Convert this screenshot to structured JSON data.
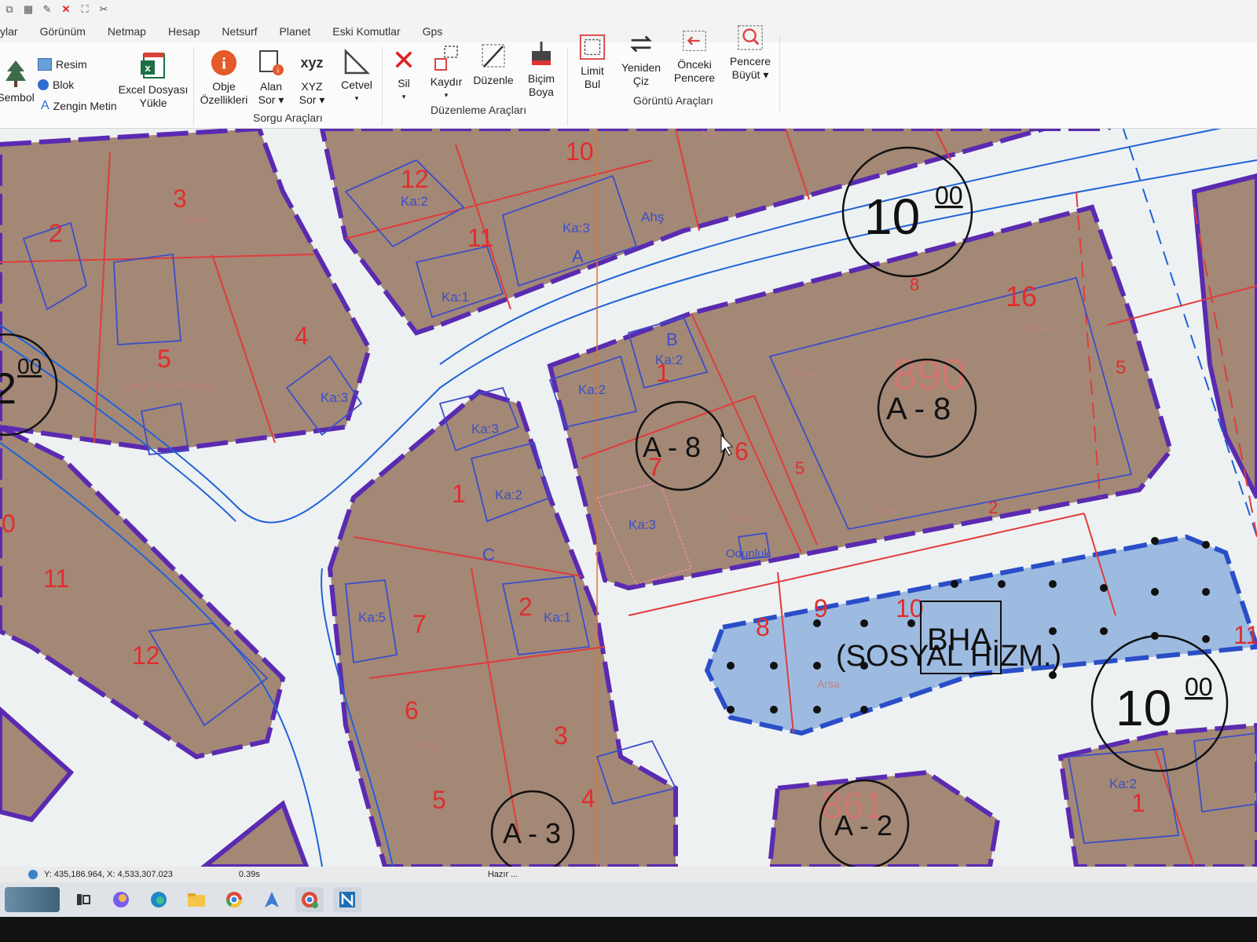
{
  "qat": {
    "icons": [
      "layers-icon",
      "grid-icon",
      "edit-icon",
      "delete-icon",
      "select-icon",
      "cut-icon"
    ]
  },
  "tabs": [
    "ylar",
    "Görünüm",
    "Netmap",
    "Hesap",
    "Netsurf",
    "Planet",
    "Eski Komutlar",
    "Gps"
  ],
  "ribbon": {
    "sembol": "Sembol",
    "resim": "Resim",
    "blok": "Blok",
    "zengin_metin": "Zengin Metin",
    "excel_line1": "Excel Dosyası",
    "excel_line2": "Yükle",
    "obje_line1": "Obje",
    "obje_line2": "Özellikleri",
    "alan_line1": "Alan",
    "alan_line2": "Sor ▾",
    "xyz_top": "xyz",
    "xyz_line1": "XYZ",
    "xyz_line2": "Sor ▾",
    "cetvel": "Cetvel",
    "sorgu_group": "Sorgu Araçları",
    "sil": "Sil",
    "kaydir": "Kaydır",
    "duzenle": "Düzenle",
    "bicim_line1": "Biçim",
    "bicim_line2": "Boya",
    "duzenleme_group": "Düzenleme Araçları",
    "limit_line1": "Limit",
    "limit_line2": "Bul",
    "yeniden_line1": "Yeniden",
    "yeniden_line2": "Çiz",
    "onceki_line1": "Önceki",
    "onceki_line2": "Pencere",
    "pencere_line1": "Pencere",
    "pencere_line2": "Büyüt ▾",
    "goruntu_group": "Görüntü Araçları"
  },
  "map": {
    "road_widths": {
      "top_right": {
        "main": "10",
        "sup": "00"
      },
      "left": {
        "main": "2",
        "sup": "00"
      },
      "bottom_right": {
        "main": "10",
        "sup": "00"
      }
    },
    "zones": [
      "A - 8",
      "A - 8",
      "A - 3",
      "A - 2"
    ],
    "block_numbers": [
      "890",
      "861"
    ],
    "parcels": [
      "3",
      "2",
      "5",
      "4",
      "12",
      "11",
      "10",
      "1",
      "6",
      "7",
      "16",
      "1",
      "2",
      "7",
      "6",
      "3",
      "5",
      "4",
      "11",
      "12",
      "0",
      "1",
      "8",
      "9",
      "10",
      "11",
      "5",
      "5",
      "2",
      "8"
    ],
    "buildings": [
      "Ka:2",
      "Ka:1",
      "Ka:3",
      "Ka:3",
      "Ka:2",
      "Ka:5",
      "Ka:1",
      "Ka:2",
      "Ka:3",
      "Ka:2",
      "Ka:2",
      "Ka:3",
      "A",
      "B",
      "C",
      "Ahş",
      "Odunluk"
    ],
    "arsa_label": "Arsa",
    "kargir_label": "Kargir Ev Ve Arsası",
    "social": "(SOSYAL HİZM.)",
    "social_code": "BHA"
  },
  "status": {
    "coords": "Y: 435,186.964, X: 4,533,307.023",
    "time": "0.39s",
    "state": "Hazır ..."
  },
  "taskbar": {
    "icons": [
      "widgets-icon",
      "task-view-icon",
      "copilot-icon",
      "edge-icon",
      "file-explorer-icon",
      "chrome-icon",
      "app-icon",
      "chrome-profile-icon",
      "netcad-icon"
    ]
  },
  "colors": {
    "parcel_fill": "#a38876",
    "block_border": "#5a2bb0",
    "parcel_line": "#e03c3c",
    "road_line": "#1e63d8",
    "social_fill": "#9dbbe0"
  }
}
